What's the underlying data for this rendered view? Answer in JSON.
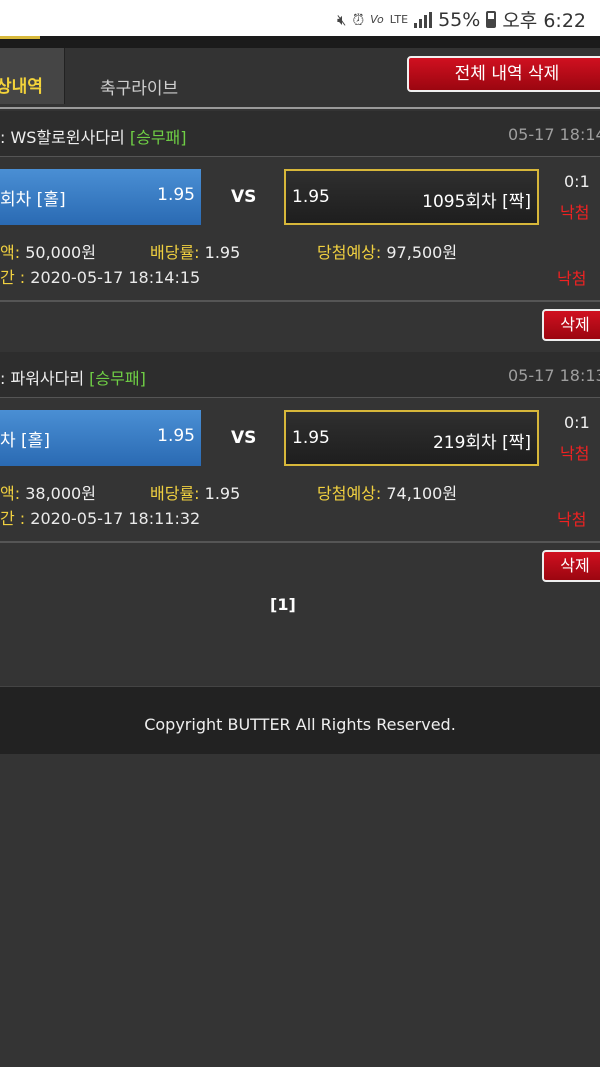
{
  "status_bar": {
    "battery": "55%",
    "time": "오후 6:22",
    "network": "LTE",
    "icons": [
      "mute-icon",
      "alarm-icon",
      "volte-icon",
      "lte-icon",
      "signal-icon",
      "battery-icon"
    ]
  },
  "tabs": {
    "active_label": "상내역",
    "live_label": "축구라이브",
    "delete_all_label": "전체 내역 삭제"
  },
  "bets": [
    {
      "game": ": WS할로윈사다리",
      "type": "[승무패]",
      "time": "05-17 18:14",
      "home_name": "회차 [홀]",
      "home_odds": "1.95",
      "vs": "VS",
      "away_odds": "1.95",
      "away_name": "1095회차 [짝]",
      "score": "0:1",
      "result": "낙첨",
      "amount_label": "액:",
      "amount": "50,000원",
      "odds_label": "배당률:",
      "odds": "1.95",
      "expected_label": "당첨예상:",
      "expected": "97,500원",
      "datetime_label": "간 :",
      "datetime": "2020-05-17 18:14:15",
      "result2": "낙첨",
      "delete_label": "삭제"
    },
    {
      "game": ": 파워사다리",
      "type": "[승무패]",
      "time": "05-17 18:13",
      "home_name": "차 [홀]",
      "home_odds": "1.95",
      "vs": "VS",
      "away_odds": "1.95",
      "away_name": "219회차 [짝]",
      "score": "0:1",
      "result": "낙첨",
      "amount_label": "액:",
      "amount": "38,000원",
      "odds_label": "배당률:",
      "odds": "1.95",
      "expected_label": "당첨예상:",
      "expected": "74,100원",
      "datetime_label": "간 :",
      "datetime": "2020-05-17 18:11:32",
      "result2": "낙첨",
      "delete_label": "삭제"
    }
  ],
  "pager": "[1]",
  "footer": "Copyright BUTTER All Rights Reserved."
}
